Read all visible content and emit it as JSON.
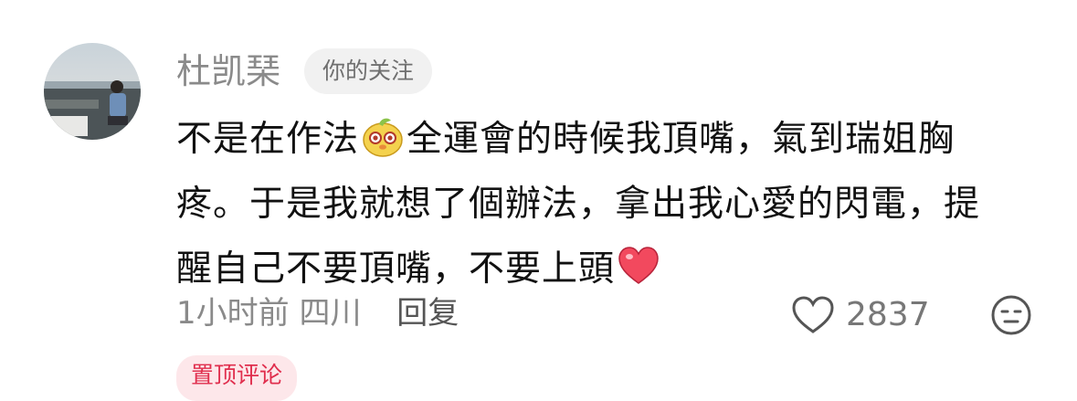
{
  "comment": {
    "username": "杜凯琹",
    "follow_tag": "你的关注",
    "text_parts": {
      "part1": "不是在作法",
      "part2": "全運會的時候我頂嘴，氣到瑞姐胸",
      "part3": "疼。于是我就想了個辦法，拿出我心愛的閃電，提",
      "part4": "醒自己不要頂嘴，不要上頭"
    },
    "emojis": [
      "cute-face-emoji",
      "red-heart-emoji"
    ],
    "time": "1小时前",
    "location": "四川",
    "reply_label": "回复",
    "like_count": "2837",
    "pinned_label": "置顶评论"
  },
  "colors": {
    "username": "#8a8a8a",
    "text": "#111111",
    "meta": "#8a8a8a",
    "pinned_text": "#e02e4d",
    "pinned_bg": "#fde7ea",
    "heart_emoji": "#f2495e"
  }
}
